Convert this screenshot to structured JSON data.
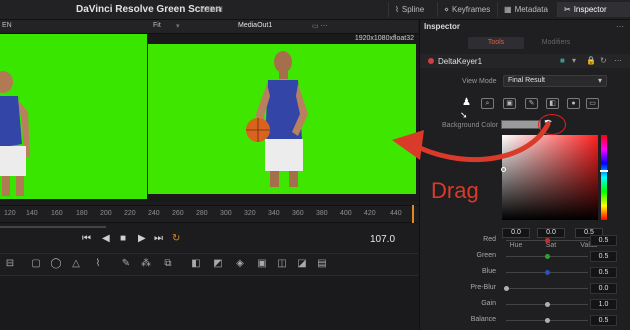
{
  "app": {
    "title": "DaVinci Resolve Green Screen",
    "status": "Edited"
  },
  "top_buttons": [
    {
      "label": "Spline",
      "icon": "spline-icon"
    },
    {
      "label": "Keyframes",
      "icon": "keyframes-icon"
    },
    {
      "label": "Metadata",
      "icon": "metadata-icon"
    },
    {
      "label": "Inspector",
      "icon": "inspector-icon",
      "active": true
    }
  ],
  "viewer": {
    "left_fragment": "EN",
    "fit_label": "Fit",
    "right_fit_label": "Fit",
    "output_name": "MediaOut1",
    "resolution": "1920x1080xfloat32"
  },
  "ruler": {
    "ticks": [
      "120",
      "140",
      "160",
      "180",
      "200",
      "220",
      "240",
      "260",
      "280",
      "300",
      "320",
      "340",
      "360",
      "380",
      "400",
      "420",
      "440"
    ]
  },
  "transport": {
    "buttons": [
      "⏮",
      "◀",
      "■",
      "▶",
      "⏭",
      "↻"
    ],
    "timecode": "107.0"
  },
  "inspector": {
    "title": "Inspector",
    "tabs": {
      "tools": "Tools",
      "modifiers": "Modifiers"
    },
    "node_name": "DeltaKeyer1",
    "view_mode_label": "View Mode",
    "view_mode_value": "Final Result",
    "background_color_label": "Background Color",
    "hsv": [
      {
        "label": "Hue",
        "value": "0.0"
      },
      {
        "label": "Sat",
        "value": "0.0"
      },
      {
        "label": "Value",
        "value": "0.5"
      }
    ],
    "params": [
      {
        "label": "Red",
        "value": "0.5",
        "accent": "#c03030",
        "level": 0.5
      },
      {
        "label": "Green",
        "value": "0.5",
        "accent": "#30a030",
        "level": 0.5
      },
      {
        "label": "Blue",
        "value": "0.5",
        "accent": "#3050c0",
        "level": 0.5
      },
      {
        "label": "Pre-Blur",
        "value": "0.0",
        "accent": "#b0b0b0",
        "level": 0.0
      },
      {
        "label": "Gain",
        "value": "1.0",
        "accent": "#b0b0b0",
        "level": 0.5
      },
      {
        "label": "Balance",
        "value": "0.5",
        "accent": "#b0b0b0",
        "level": 0.5
      }
    ]
  },
  "annotation": {
    "text": "Drag",
    "color": "#d93a2a"
  },
  "colors": {
    "green_screen": "#3ee600",
    "accent_red": "#e05a4a",
    "playhead": "#e08a1e"
  }
}
